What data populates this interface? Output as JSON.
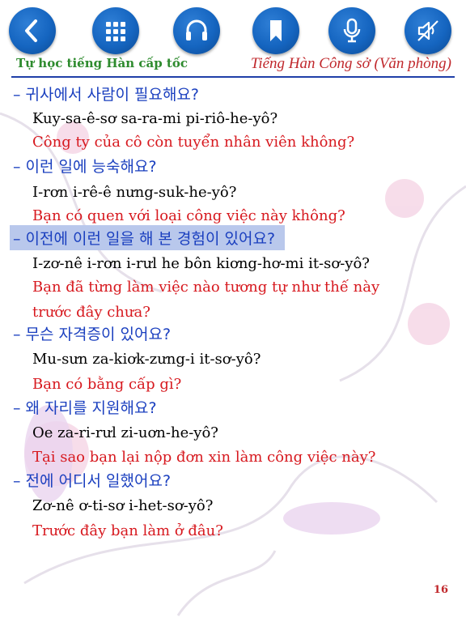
{
  "toolbar": {
    "buttons": [
      {
        "icon": "back-icon"
      },
      {
        "icon": "grid-icon"
      },
      {
        "icon": "headphones-icon"
      },
      {
        "icon": "bookmark-icon"
      },
      {
        "icon": "microphone-icon"
      },
      {
        "icon": "sound-off-icon"
      }
    ],
    "accent": "#1565c0"
  },
  "header": {
    "left": "Tự học tiếng Hàn cấp tốc",
    "right": "Tiếng Hàn Công sở (Văn phòng)"
  },
  "phrases": [
    {
      "korean": "– 귀사에서 사람이 필요해요?",
      "romanization": "Kuy-sa-ê-sơ sa-ra-mi pi-riô-he-yô?",
      "vietnamese": "Công ty của cô còn tuyển nhân viên không?",
      "highlighted": false
    },
    {
      "korean": "– 이런 일에 능숙해요?",
      "romanization": "I-rơn i-rê-ê nưng-suk-he-yô?",
      "vietnamese": "Bạn có quen với loại công việc này không?",
      "highlighted": false
    },
    {
      "korean": "– 이전에 이런 일을 해 본 경험이 있어요?",
      "romanization": "I-zơ-nê i-rơn i-rưl he bôn kiơng-hơ-mi it-sơ-yô?",
      "vietnamese_lines": [
        "Bạn đã từng làm việc nào tương tự như thế này",
        "trước đây chưa?"
      ],
      "highlighted": true
    },
    {
      "korean": "– 무슨 자격증이 있어요?",
      "romanization": "Mu-sưn za-kiơk-zưng-i it-sơ-yô?",
      "vietnamese": "Bạn có bằng cấp gì?",
      "highlighted": false
    },
    {
      "korean": "– 왜 자리를 지원해요?",
      "romanization": "Oe za-ri-rưl zi-uơn-he-yô?",
      "vietnamese": "Tại sao bạn lại nộp đơn xin làm công việc này?",
      "highlighted": false
    },
    {
      "korean": "– 전에 어디서 일했어요?",
      "romanization": "Zơ-nê ơ-ti-sơ i-het-sơ-yô?",
      "vietnamese": "Trước đây bạn làm ở đâu?",
      "highlighted": false
    }
  ],
  "page_number": "16"
}
